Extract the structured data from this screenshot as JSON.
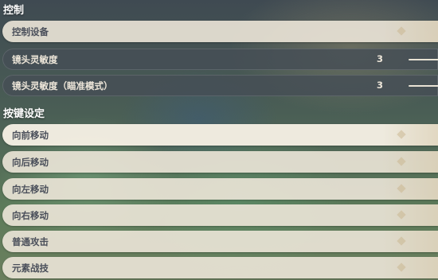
{
  "control_section": {
    "title": "控制",
    "rows": [
      {
        "label": "控制设备"
      },
      {
        "label": "镜头灵敏度",
        "value": "3"
      },
      {
        "label": "镜头灵敏度（瞄准模式）",
        "value": "3"
      }
    ]
  },
  "keybind_section": {
    "title": "按键设定",
    "rows": [
      {
        "label": "向前移动"
      },
      {
        "label": "向后移动"
      },
      {
        "label": "向左移动"
      },
      {
        "label": "向右移动"
      },
      {
        "label": "普通攻击"
      },
      {
        "label": "元素战技"
      }
    ]
  }
}
